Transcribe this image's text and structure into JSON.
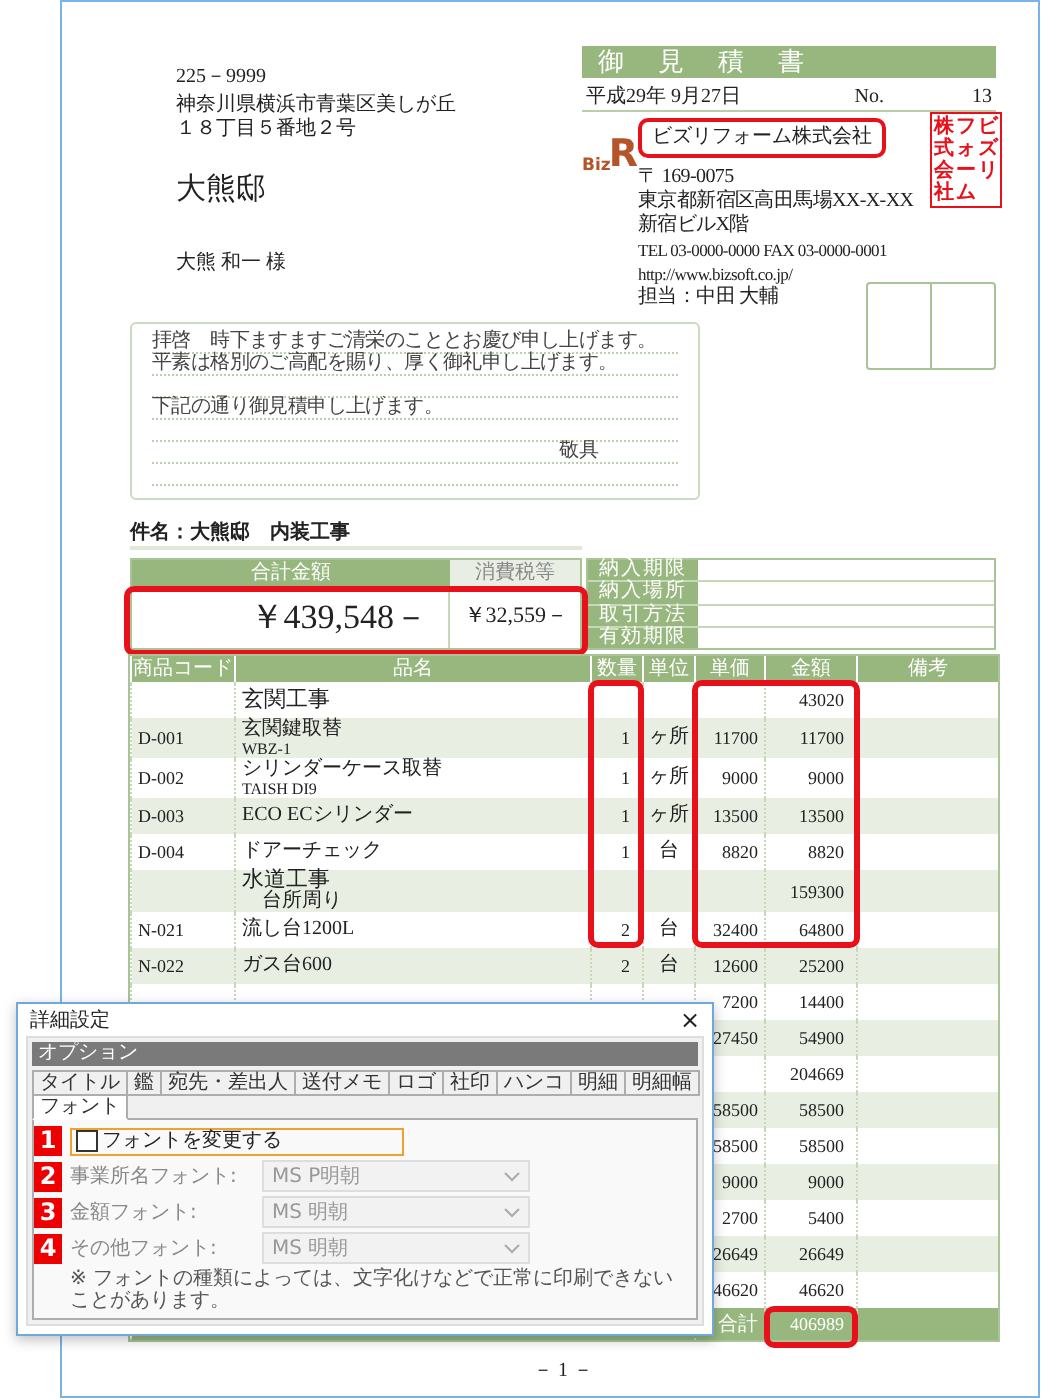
{
  "recipient": {
    "postal": "225－9999",
    "address": [
      "神奈川県横浜市青葉区美しが丘",
      "１８丁目５番地２号"
    ],
    "house": "大熊邸",
    "name": "大熊 和一 様"
  },
  "header": {
    "title": "御　見　積　書",
    "date": "平成29年 9月27日",
    "no_label": "No.",
    "no": "13"
  },
  "company": {
    "logo": {
      "text": "Biz",
      "letter": "R"
    },
    "name": "ビズリフォーム株式会社",
    "postal": "〒 169-0075",
    "address": [
      "東京都新宿区高田馬場XX-X-XX",
      "新宿ビルX階"
    ],
    "tel": "TEL 03-0000-0000  FAX 03-0000-0001",
    "url": "http://www.bizsoft.co.jp/",
    "contact": "担当：中田 大輔"
  },
  "stamp": {
    "columns": [
      "株式会社",
      "フォーム",
      "ビズリ"
    ]
  },
  "letter": {
    "greeting": [
      "拝啓　時下ますますご清栄のこととお慶び申し上げます。",
      "平素は格別のご高配を賜り、厚く御礼申し上げます。"
    ],
    "body": [
      "下記の通り御見積申し上げます。"
    ],
    "closing": "敬具"
  },
  "subject": "件名：大熊邸　内装工事",
  "totals": {
    "total_label": "合計金額",
    "total": "￥439,548－",
    "tax_label": "消費税等",
    "tax": "￥32,559－"
  },
  "terms": [
    "納入期限",
    "納入場所",
    "取引方法",
    "有効期限"
  ],
  "table": {
    "columns": [
      "商品コード",
      "品名",
      "数量",
      "単位",
      "単価",
      "金額",
      "備考"
    ],
    "rows": [
      {
        "kind": "category",
        "name": [
          "玄関工事"
        ],
        "amount": "43020"
      },
      {
        "kind": "item",
        "code": "D-001",
        "name": [
          "玄関鍵取替",
          "WBZ-1"
        ],
        "qty": "1",
        "unit": "ヶ所",
        "price": "11700",
        "amount": "11700"
      },
      {
        "kind": "item",
        "code": "D-002",
        "name": [
          "シリンダーケース取替",
          "TAISH DI9"
        ],
        "qty": "1",
        "unit": "ヶ所",
        "price": "9000",
        "amount": "9000"
      },
      {
        "kind": "item",
        "code": "D-003",
        "name": [
          "ECO ECシリンダー"
        ],
        "qty": "1",
        "unit": "ヶ所",
        "price": "13500",
        "amount": "13500"
      },
      {
        "kind": "item",
        "code": "D-004",
        "name": [
          "ドアーチェック"
        ],
        "qty": "1",
        "unit": "台",
        "price": "8820",
        "amount": "8820"
      },
      {
        "kind": "category",
        "name": [
          "水道工事",
          "台所周り"
        ],
        "amount": "159300"
      },
      {
        "kind": "item",
        "code": "N-021",
        "name": [
          "流し台1200L"
        ],
        "qty": "2",
        "unit": "台",
        "price": "32400",
        "amount": "64800"
      },
      {
        "kind": "item",
        "code": "N-022",
        "name": [
          "ガス台600"
        ],
        "qty": "2",
        "unit": "台",
        "price": "12600",
        "amount": "25200"
      },
      {
        "kind": "item",
        "price": "7200",
        "amount": "14400"
      },
      {
        "kind": "item",
        "price": "27450",
        "amount": "54900"
      },
      {
        "kind": "item",
        "amount": "204669"
      },
      {
        "kind": "item",
        "price": "58500",
        "amount": "58500"
      },
      {
        "kind": "item",
        "price": "58500",
        "amount": "58500"
      },
      {
        "kind": "item",
        "price": "9000",
        "amount": "9000"
      },
      {
        "kind": "item",
        "price": "2700",
        "amount": "5400"
      },
      {
        "kind": "item",
        "price": "26649",
        "amount": "26649"
      },
      {
        "kind": "item",
        "price": "46620",
        "amount": "46620"
      }
    ],
    "total": {
      "label": "合計",
      "amount": "406989"
    }
  },
  "page_number": "－ 1 －",
  "dialog": {
    "title": "詳細設定",
    "close": "×",
    "group": "オプション",
    "tabs": [
      {
        "label": "タイトル",
        "selected": false
      },
      {
        "label": "鑑",
        "selected": false
      },
      {
        "label": "宛先・差出人",
        "selected": false
      },
      {
        "label": "送付メモ",
        "selected": false
      },
      {
        "label": "ロゴ",
        "selected": false
      },
      {
        "label": "社印",
        "selected": false
      },
      {
        "label": "ハンコ",
        "selected": false
      },
      {
        "label": "明細",
        "selected": false
      },
      {
        "label": "明細幅",
        "selected": false
      },
      {
        "label": "フォント",
        "selected": true
      }
    ],
    "option": {
      "badge": "1",
      "label": "フォントを変更する",
      "checked": false,
      "focused": true
    },
    "fonts": [
      {
        "badge": "2",
        "label": "事業所名フォント:",
        "value": "MS P明朝",
        "disabled": true
      },
      {
        "badge": "3",
        "label": "金額フォント:",
        "value": "MS 明朝",
        "disabled": true
      },
      {
        "badge": "4",
        "label": "その他フォント:",
        "value": "MS 明朝",
        "disabled": true
      }
    ],
    "note": "※ フォントの種類によっては、文字化けなどで正常に印刷できないことがあります。"
  }
}
